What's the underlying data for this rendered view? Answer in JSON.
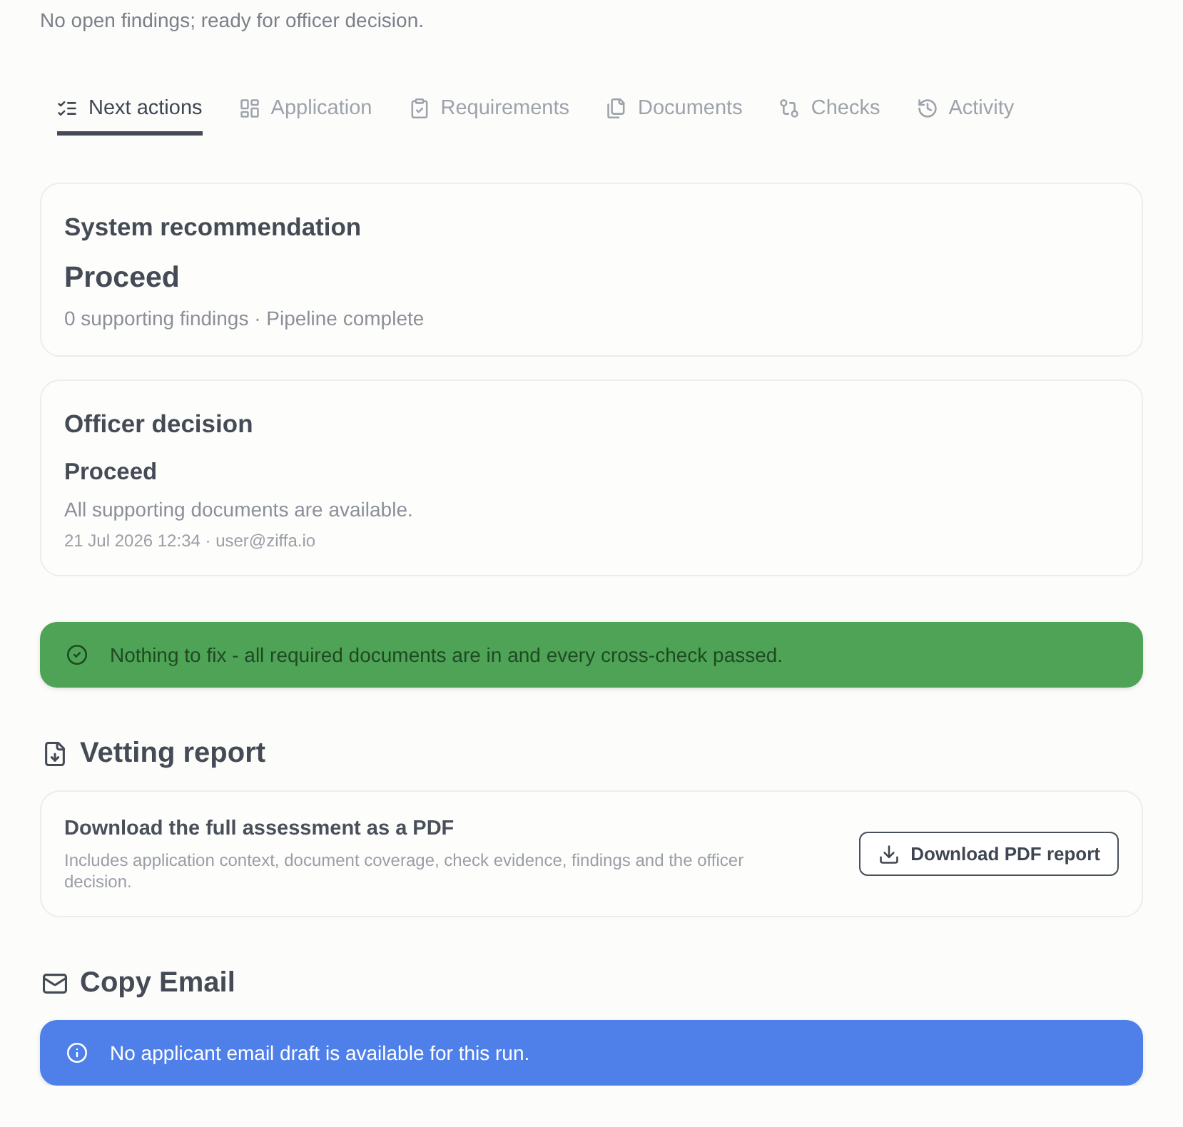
{
  "summary": "No open findings; ready for officer decision.",
  "tabs": [
    {
      "label": "Next actions",
      "selected": true
    },
    {
      "label": "Application",
      "selected": false
    },
    {
      "label": "Requirements",
      "selected": false
    },
    {
      "label": "Documents",
      "selected": false
    },
    {
      "label": "Checks",
      "selected": false
    },
    {
      "label": "Activity",
      "selected": false
    }
  ],
  "system_recommendation": {
    "title": "System recommendation",
    "verdict": "Proceed",
    "detail": "0 supporting findings · Pipeline complete"
  },
  "officer_decision": {
    "title": "Officer decision",
    "verdict": "Proceed",
    "note": "All supporting documents are available.",
    "meta": "21 Jul 2026 12:34 · user@ziffa.io"
  },
  "status_alert": {
    "kind": "success",
    "text": "Nothing to fix - all required documents are in and every cross-check passed."
  },
  "vetting_report": {
    "heading": "Vetting report",
    "title": "Download the full assessment as a PDF",
    "description": "Includes application context, document coverage, check evidence, findings and the officer decision.",
    "button": "Download PDF report"
  },
  "copy_email": {
    "heading": "Copy Email",
    "alert": {
      "kind": "info",
      "text": "No applicant email draft is available for this run."
    }
  }
}
